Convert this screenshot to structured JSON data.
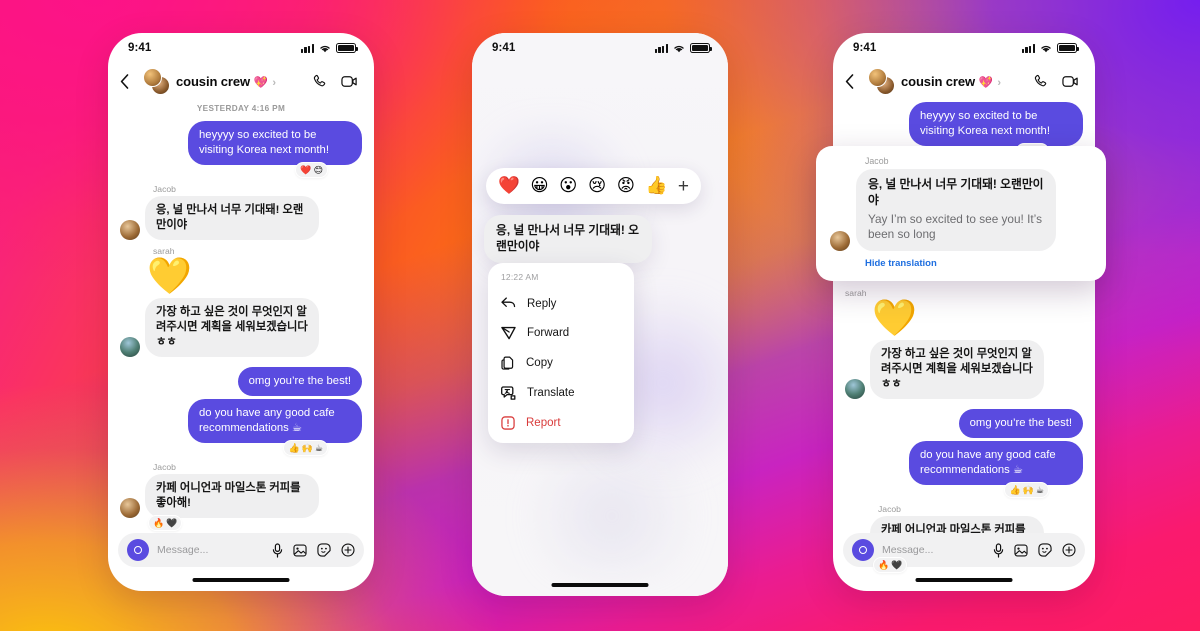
{
  "background": {
    "gradient_colors": [
      "#F81E7C",
      "#FC7A0B",
      "#FFC107",
      "#7C1BF5",
      "#C416D0",
      "#FD1C60"
    ]
  },
  "theme": {
    "outgoing_bubble": "#5A4BE0",
    "incoming_bubble": "#EFEFF0",
    "link_blue": "#1F6FE0",
    "danger_red": "#D93B3B"
  },
  "status_bar": {
    "time": "9:41"
  },
  "header": {
    "title": "cousin crew",
    "title_emoji": "💖",
    "chevron": "›"
  },
  "thread": {
    "daystamp": "YESTERDAY 4:16 PM",
    "messages": [
      {
        "id": "m1",
        "direction": "out",
        "text": "heyyyy so excited to be visiting Korea next month!",
        "reactions": [
          "❤️",
          "😊"
        ]
      },
      {
        "id": "m2",
        "direction": "in",
        "sender": "Jacob",
        "text": "응, 널 만나서 너무 기대돼! 오랜만이야",
        "translation": "Yay I’m so excited to see you! It’s been so long"
      },
      {
        "id": "m3",
        "direction": "in",
        "sender": "sarah",
        "big_emoji": "💛",
        "text": ""
      },
      {
        "id": "m4",
        "direction": "in",
        "text": "가장 하고 싶은 것이 무엇인지 알려주시면 계획을 세워보겠습니다 ㅎㅎ"
      },
      {
        "id": "m5",
        "direction": "out",
        "text": "omg you’re the best!"
      },
      {
        "id": "m6",
        "direction": "out",
        "text": "do you have any good cafe recommendations ☕",
        "reactions": [
          "👍",
          "🙌",
          "☕"
        ]
      },
      {
        "id": "m7",
        "direction": "in",
        "sender": "Jacob",
        "text": "카페 어니언과 마일스톤 커피를 좋아해!",
        "reactions": [
          "🔥",
          "🖤"
        ]
      }
    ]
  },
  "composer": {
    "placeholder": "Message...",
    "icons": [
      "camera-icon",
      "microphone-icon",
      "photo-icon",
      "sticker-icon",
      "plus-icon"
    ]
  },
  "reaction_bar": {
    "emojis": [
      "❤️",
      "😀",
      "😮",
      "😢",
      "😡",
      "👍"
    ],
    "more_label": "+"
  },
  "context_menu": {
    "timestamp": "12:22 AM",
    "items": [
      {
        "label": "Reply",
        "icon": "reply-arrow-icon"
      },
      {
        "label": "Forward",
        "icon": "forward-paper-plane-icon"
      },
      {
        "label": "Copy",
        "icon": "copy-pages-icon"
      },
      {
        "label": "Translate",
        "icon": "translate-icon"
      },
      {
        "label": "Report",
        "icon": "report-warning-icon",
        "danger": true
      }
    ]
  },
  "translation_card": {
    "sender": "Jacob",
    "original": "응, 널 만나서 너무 기대돼! 오랜만이야",
    "translated": "Yay I’m so excited to see you! It’s been so long",
    "hide_label": "Hide translation"
  }
}
